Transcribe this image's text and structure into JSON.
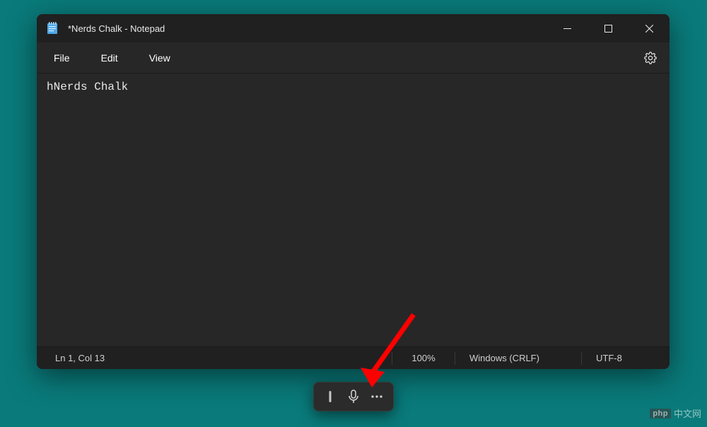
{
  "titlebar": {
    "title": "*Nerds Chalk - Notepad"
  },
  "menubar": {
    "file": "File",
    "edit": "Edit",
    "view": "View"
  },
  "editor": {
    "content": "hNerds Chalk"
  },
  "statusbar": {
    "position": "Ln 1, Col 13",
    "zoom": "100%",
    "line_ending": "Windows (CRLF)",
    "encoding": "UTF-8"
  },
  "watermark": {
    "brand": "php",
    "text": "中文网"
  }
}
